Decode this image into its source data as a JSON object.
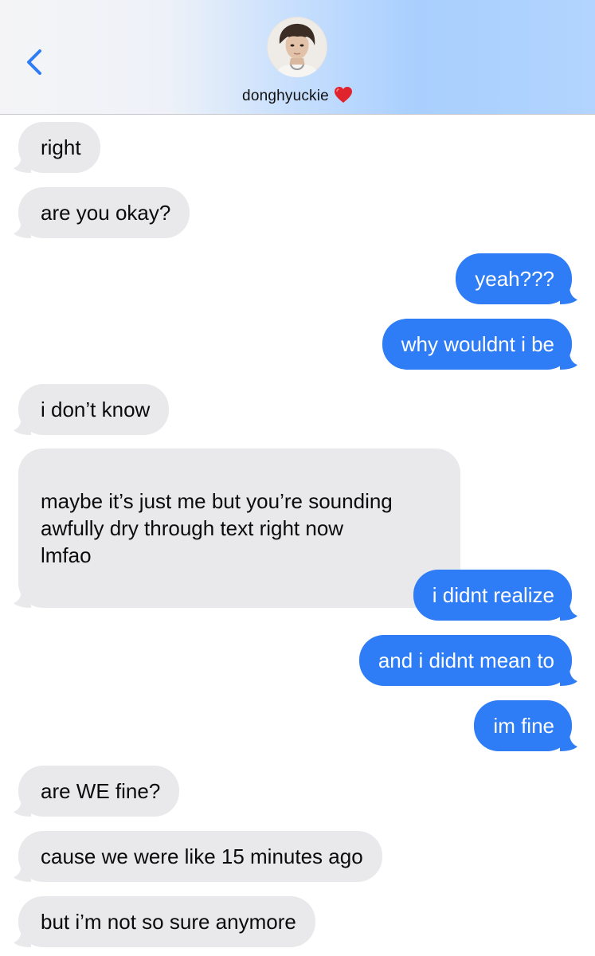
{
  "header": {
    "contact_name": "donghyuckie",
    "heart_icon": "red-heart-emoji",
    "back_icon": "chevron-left-icon",
    "accent": "#2e7cf6"
  },
  "messages": [
    {
      "from": "them",
      "text": "right"
    },
    {
      "from": "them",
      "text": "are you okay?"
    },
    {
      "from": "me",
      "text": "yeah???"
    },
    {
      "from": "me",
      "text": "why wouldnt i be"
    },
    {
      "from": "them",
      "text": "i don’t know"
    },
    {
      "from": "them",
      "text": "maybe it’s just me but you’re sounding\nawfully dry through text right now\nlmfao"
    },
    {
      "from": "me",
      "text": "i didnt realize"
    },
    {
      "from": "me",
      "text": "and i didnt mean to"
    },
    {
      "from": "me",
      "text": "im fine"
    },
    {
      "from": "them",
      "text": "are WE fine?"
    },
    {
      "from": "them",
      "text": "cause we were like 15 minutes ago"
    },
    {
      "from": "them",
      "text": "but i’m not so sure anymore"
    }
  ],
  "colors": {
    "incoming_bubble": "#e9e9eb",
    "outgoing_bubble": "#2e7cf6"
  }
}
